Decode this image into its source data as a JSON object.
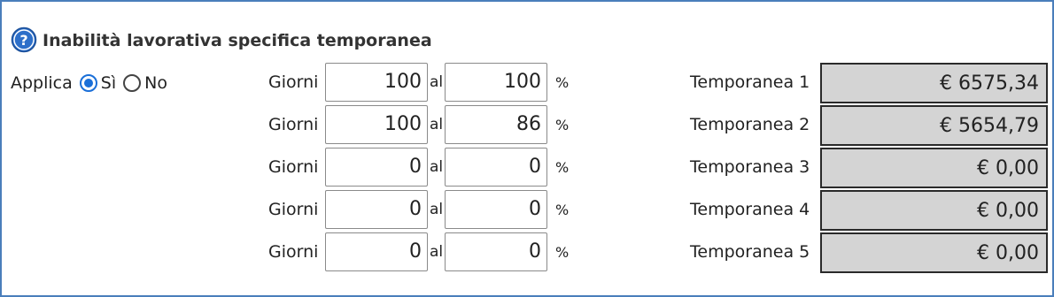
{
  "section": {
    "title": "Inabilità lavorativa specifica temporanea",
    "help_icon": "question-circle-icon"
  },
  "applica": {
    "label": "Applica",
    "options": [
      {
        "label": "Sì",
        "checked": true
      },
      {
        "label": "No",
        "checked": false
      }
    ]
  },
  "rows": [
    {
      "giorni_label": "Giorni",
      "from": "100",
      "al_label": "al",
      "to": "100",
      "pct_label": "%",
      "temp_label": "Temporanea 1",
      "result": "€ 6575,34"
    },
    {
      "giorni_label": "Giorni",
      "from": "100",
      "al_label": "al",
      "to": "86",
      "pct_label": "%",
      "temp_label": "Temporanea 2",
      "result": "€ 5654,79"
    },
    {
      "giorni_label": "Giorni",
      "from": "0",
      "al_label": "al",
      "to": "0",
      "pct_label": "%",
      "temp_label": "Temporanea 3",
      "result": "€ 0,00"
    },
    {
      "giorni_label": "Giorni",
      "from": "0",
      "al_label": "al",
      "to": "0",
      "pct_label": "%",
      "temp_label": "Temporanea 4",
      "result": "€ 0,00"
    },
    {
      "giorni_label": "Giorni",
      "from": "0",
      "al_label": "al",
      "to": "0",
      "pct_label": "%",
      "temp_label": "Temporanea 5",
      "result": "€ 0,00"
    }
  ],
  "colors": {
    "accent": "#1a6fd8",
    "frame_border": "#4a7ebb",
    "result_bg": "#d4d4d4"
  }
}
